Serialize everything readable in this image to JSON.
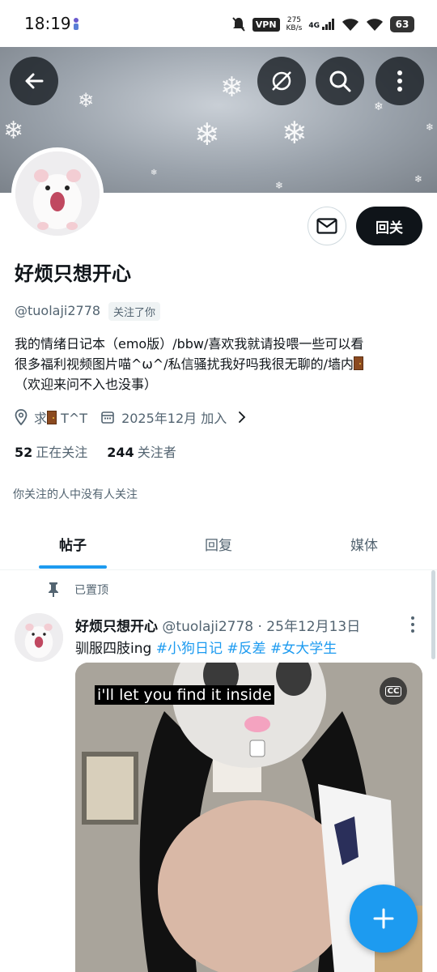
{
  "status_bar": {
    "time": "18:19",
    "vpn_label": "VPN",
    "speed_value": "275",
    "speed_unit": "KB/s",
    "network": "4G",
    "battery": "63"
  },
  "profile": {
    "display_name": "好烦只想开心",
    "handle": "@tuolaji2778",
    "follows_you": "关注了你",
    "bio_line1": "我的情绪日记本（emo版）/bbw/喜欢我就请投喂一些可以看",
    "bio_line2": "很多福利视频图片喵^ω^/私信骚扰我好吗我很无聊的/墙内",
    "bio_line3": "（欢迎来问不入也没事）",
    "location": "求",
    "location_suffix": "T^T",
    "joined": "2025年12月 加入",
    "following_count": "52",
    "following_label": "正在关注",
    "followers_count": "244",
    "followers_label": "关注者",
    "mutual_note": "你关注的人中没有人关注"
  },
  "actions": {
    "follow_back": "回关"
  },
  "tabs": [
    {
      "label": "帖子",
      "active": true
    },
    {
      "label": "回复",
      "active": false
    },
    {
      "label": "媒体",
      "active": false
    }
  ],
  "post": {
    "pinned_label": "已置顶",
    "author_name": "好烦只想开心",
    "author_meta": "@tuolaji2778 · 25年12月13日",
    "text": "驯服四肢ing",
    "tags": [
      "#小狗日记",
      "#反差",
      "#女大学生"
    ],
    "video_caption": "i'll let you find it inside",
    "cc_label": "CC"
  },
  "colors": {
    "accent": "#1d9bf0",
    "text_primary": "#0f1419",
    "text_secondary": "#536471"
  }
}
